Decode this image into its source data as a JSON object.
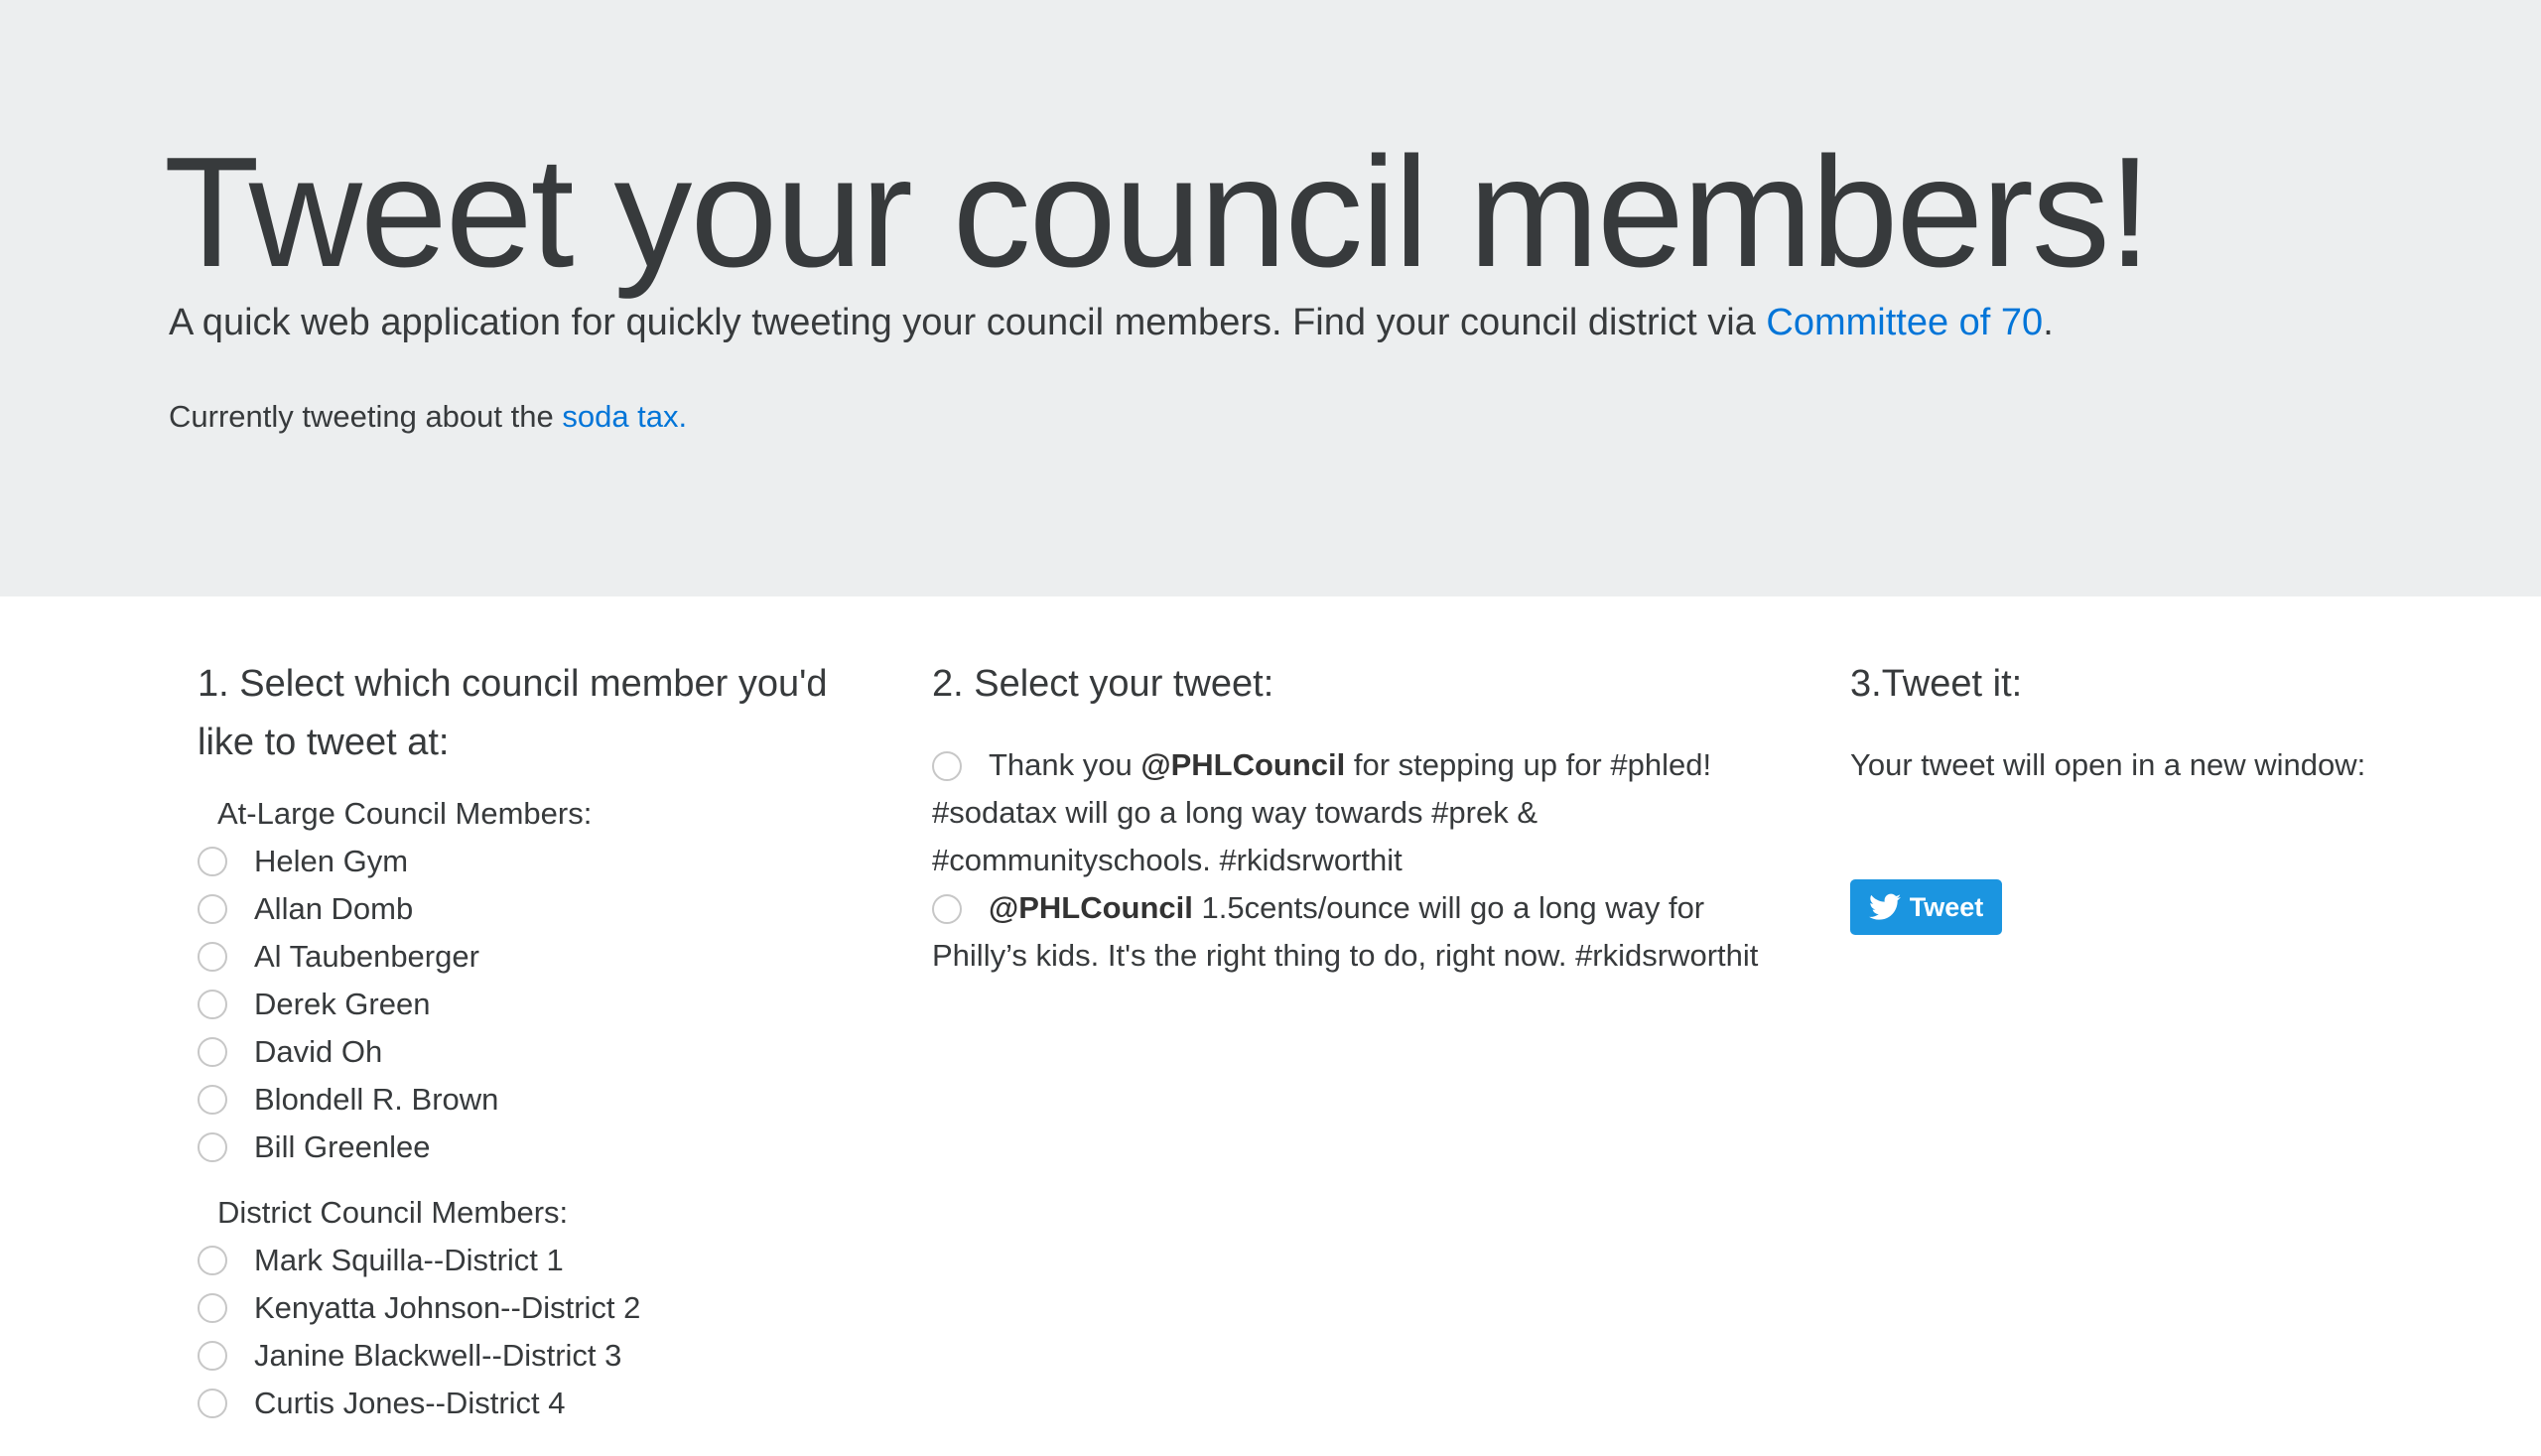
{
  "header": {
    "title": "Tweet your council members!",
    "lead_text": "A quick web application for quickly tweeting your council members. Find your council district via ",
    "lead_link": "Committee of 70",
    "lead_end": ".",
    "current_text": "Currently tweeting about the ",
    "current_link": "soda tax."
  },
  "step1": {
    "heading": "1. Select which council member you'd like to tweet at:",
    "at_large_label": "At-Large Council Members:",
    "at_large": [
      "Helen Gym",
      "Allan Domb",
      "Al Taubenberger",
      "Derek Green",
      "David Oh",
      "Blondell R. Brown",
      "Bill Greenlee"
    ],
    "district_label": "District Council Members:",
    "district": [
      "Mark Squilla--District 1",
      "Kenyatta Johnson--District 2",
      "Janine Blackwell--District 3",
      "Curtis Jones--District 4"
    ]
  },
  "step2": {
    "heading": "2. Select your tweet:",
    "tweets": [
      {
        "pre": "Thank you ",
        "handle": "@PHLCouncil",
        "post": " for stepping up for #phled! #sodatax will go a long way towards #prek & #communityschools. #rkidsrworthit"
      },
      {
        "pre": "",
        "handle": "@PHLCouncil",
        "post": " 1.5cents/ounce will go a long way for Philly’s kids. It's the right thing to do, right now. #rkidsrworthit"
      }
    ]
  },
  "step3": {
    "heading": "3.Tweet it:",
    "info": "Your tweet will open in a new window:",
    "button_label": "Tweet",
    "button_color": "#1b95e0"
  },
  "colors": {
    "link": "#0275d8",
    "jumbotron_bg": "#eceeef"
  }
}
